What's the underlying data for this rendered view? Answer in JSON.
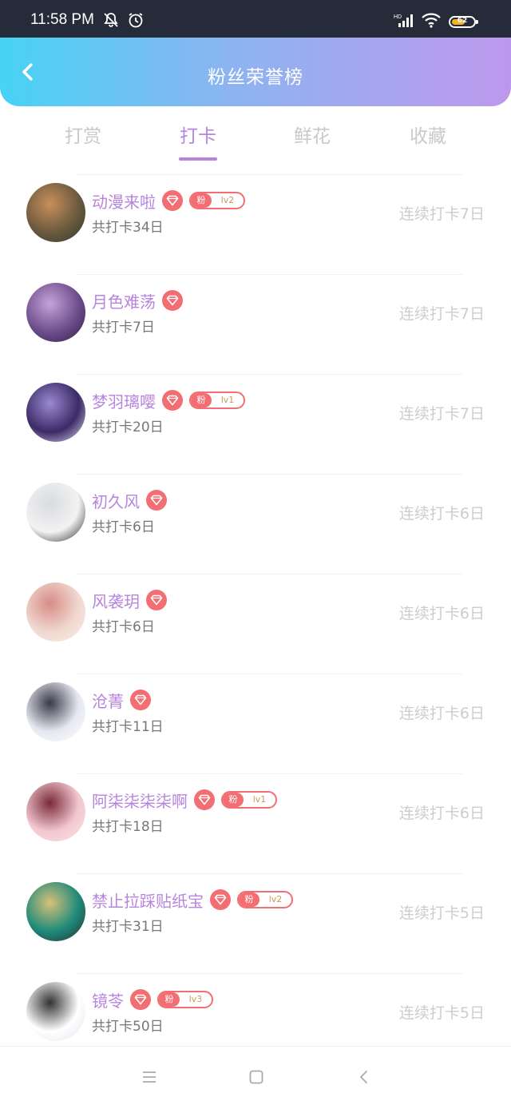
{
  "status": {
    "time": "11:58 PM",
    "battery": "62"
  },
  "header": {
    "title": "粉丝荣誉榜"
  },
  "tabs": [
    "打赏",
    "打卡",
    "鲜花",
    "收藏"
  ],
  "active_tab": 1,
  "fans": [
    {
      "name": "动漫来啦",
      "fan_label": "粉",
      "level": "lv2",
      "total": "共打卡34日",
      "streak": "连续打卡7日",
      "avatar_colors": [
        "#6b5a3e",
        "#c98f5b",
        "#2f3a2e"
      ]
    },
    {
      "name": "月色难荡",
      "fan_label": "",
      "level": "",
      "total": "共打卡7日",
      "streak": "连续打卡7日",
      "avatar_colors": [
        "#6d4d8c",
        "#c5a3d8",
        "#2a2040"
      ]
    },
    {
      "name": "梦羽璃嘤",
      "fan_label": "粉",
      "level": "lv1",
      "total": "共打卡20日",
      "streak": "连续打卡7日",
      "avatar_colors": [
        "#3a2a66",
        "#9a8ad0",
        "#e8e0f4"
      ]
    },
    {
      "name": "初久风",
      "fan_label": "",
      "level": "",
      "total": "共打卡6日",
      "streak": "连续打卡6日",
      "avatar_colors": [
        "#f2f2f2",
        "#d9dbe0",
        "#222222"
      ]
    },
    {
      "name": "风袭玥",
      "fan_label": "",
      "level": "",
      "total": "共打卡6日",
      "streak": "连续打卡6日",
      "avatar_colors": [
        "#f0d8d0",
        "#d78c85",
        "#fbeee8"
      ]
    },
    {
      "name": "沧菁",
      "fan_label": "",
      "level": "",
      "total": "共打卡11日",
      "streak": "连续打卡6日",
      "avatar_colors": [
        "#e6e8f2",
        "#3a3a48",
        "#ffffff"
      ]
    },
    {
      "name": "阿柒柒柒柒啊",
      "fan_label": "粉",
      "level": "lv1",
      "total": "共打卡18日",
      "streak": "连续打卡6日",
      "avatar_colors": [
        "#f3c7cf",
        "#7a2a3a",
        "#f7e6ea"
      ]
    },
    {
      "name": "禁止拉踩贴纸宝",
      "fan_label": "粉",
      "level": "lv2",
      "total": "共打卡31日",
      "streak": "连续打卡5日",
      "avatar_colors": [
        "#1e8a7a",
        "#d8c07a",
        "#2a2a2a"
      ]
    },
    {
      "name": "镜苓",
      "fan_label": "粉",
      "level": "lv3",
      "total": "共打卡50日",
      "streak": "连续打卡5日",
      "avatar_colors": [
        "#ffffff",
        "#333333",
        "#e0e4ee"
      ]
    }
  ],
  "colors": {
    "accent": "#b784de",
    "badge": "#f26e72",
    "header_start": "#47d2f5",
    "header_end": "#bd98ec"
  }
}
